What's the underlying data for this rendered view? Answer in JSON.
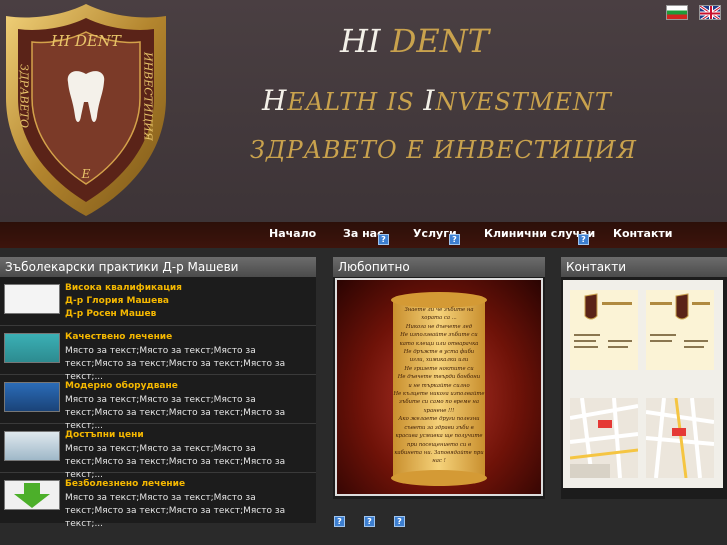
{
  "header": {
    "title_part1": "HI",
    "title_part2": "DENT",
    "subtitle_h": "H",
    "subtitle_ealth": "EALTH IS ",
    "subtitle_i": "I",
    "subtitle_nvestment": "NVESTMENT",
    "tagline": "ЗДРАВЕТО Е ИНВЕСТИЦИЯ",
    "logo_top": "HI DENT",
    "logo_left": "ЗДРАВЕТО",
    "logo_right": "ИНВЕСТИЦИЯ",
    "logo_bottom": "Е"
  },
  "nav": {
    "items": [
      "Начало",
      "За нас",
      "Услуги",
      "Клинични случаи",
      "Контакти"
    ]
  },
  "left_panel": {
    "title": "Зъболекарски практики Д-р Машеви",
    "first_item": {
      "title": "Висока квалификация",
      "line2": "Д-р Глория Машева",
      "line3": "Д-р Росен Машев"
    },
    "items": [
      {
        "title": "Качествено лечение",
        "text": "Място за текст;Място за текст;Място за текст;Място за текст;Място за текст;Място за текст;..."
      },
      {
        "title": "Модерно оборудване",
        "text": "Място за текст;Място за текст;Място за текст;Място за текст;Място за текст;Място за текст;..."
      },
      {
        "title": "Достъпни цени",
        "text": "Място за текст;Място за текст;Място за текст;Място за текст;Място за текст;Място за текст;..."
      },
      {
        "title": "Безболезнено лечение",
        "text": "Място за текст;Място за текст;Място за текст;Място за текст;Място за текст;Място за текст;..."
      }
    ]
  },
  "mid_panel": {
    "title": "Любопитно",
    "scroll_lines": [
      "Знаете ли че зъбите на",
      "хората са ...",
      "Никога не дъвчете лед",
      "Не използвайте зъбите си",
      "като клещи или отварачка",
      "Не дръжте в уста фиби",
      "игли, химикалки или",
      "Не гризете ноктите си",
      "Не дъвчете твърди бонбони",
      "и не търкайте силно",
      "Не кълцете никога изполвайте",
      "зъбите си само по време на",
      "хранене !!!",
      "Ако желаете други полезни",
      "съвети за здрави зъби в",
      "красива усмивка ще получите",
      "при посещението си в",
      "кабинета ни. Заповядайте при",
      "нас !"
    ]
  },
  "right_panel": {
    "title": "Контакти"
  },
  "colors": {
    "accent_gold": "#c9a24d",
    "item_title": "#f5b800",
    "nav_bg": "#2c0f09"
  }
}
